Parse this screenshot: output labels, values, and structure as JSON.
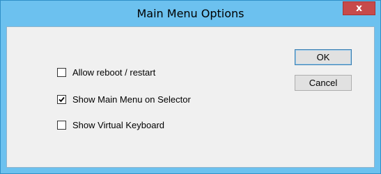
{
  "window": {
    "title": "Main Menu Options",
    "close_glyph": "x"
  },
  "options": [
    {
      "label": "Allow reboot / restart",
      "checked": false
    },
    {
      "label": "Show Main Menu on Selector",
      "checked": true
    },
    {
      "label": "Show Virtual Keyboard",
      "checked": false
    }
  ],
  "buttons": {
    "ok_label": "OK",
    "cancel_label": "Cancel"
  },
  "colors": {
    "titlebar": "#6cc1ef",
    "close_button": "#c74a4a",
    "client_background": "#f0f0f0"
  },
  "icons": {
    "close": "close-icon",
    "check": "checkmark-icon"
  }
}
